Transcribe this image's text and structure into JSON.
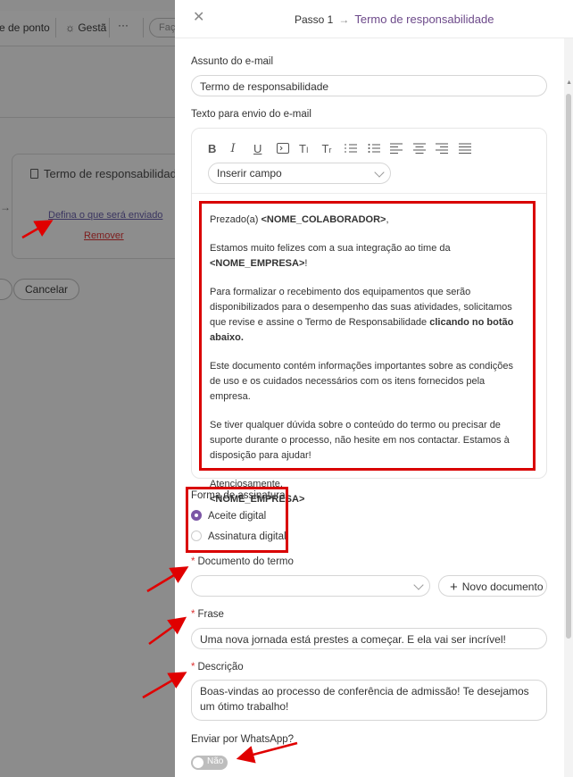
{
  "background": {
    "topbar": {
      "item1": "e de ponto",
      "item2": "Gestã",
      "more": "···",
      "search": "Faça"
    },
    "card": {
      "title": "Termo de responsabilidade",
      "define_link": "Defina o que será enviado",
      "remove_link": "Remover"
    },
    "cancel_button": "Cancelar"
  },
  "drawer": {
    "step_label": "Passo 1",
    "step_title": "Termo de responsabilidade"
  },
  "form": {
    "subject_label": "Assunto do e-mail",
    "subject_value": "Termo de responsabilidade",
    "body_label": "Texto para envio do e-mail",
    "insert_field": "Inserir campo",
    "editor": {
      "greeting_prefix": "Prezado(a) ",
      "greeting_var": "<NOME_COLABORADOR>",
      "greeting_suffix": ",",
      "p2_text": "Estamos muito felizes com a sua integração ao time da ",
      "p2_var": "<NOME_EMPRESA>",
      "p2_suffix": "!",
      "p3_text": "Para formalizar o recebimento dos equipamentos que serão disponibilizados para o desempenho das suas atividades, solicitamos que revise e assine o Termo de Responsabilidade ",
      "p3_bold": "clicando no botão abaixo.",
      "p4": "Este documento contém informações importantes sobre as condições de uso e os cuidados necessários com os itens fornecidos pela empresa.",
      "p5": "Se tiver qualquer dúvida sobre o conteúdo do termo ou precisar de suporte durante o processo, não hesite em nos contactar. Estamos à disposição para ajudar!",
      "closing": "Atenciosamente,",
      "signature_var": "<NOME_EMPRESA>"
    },
    "signature_label": "Forma de assinatura",
    "signature_options": [
      "Aceite digital",
      "Assinatura digital"
    ],
    "signature_selected": "Aceite digital",
    "document_label": "Documento do termo",
    "document_value": "",
    "new_document_button": "Novo documento",
    "phrase_label": "Frase",
    "phrase_value": "Uma nova jornada está prestes a começar. E ela vai ser incrível!",
    "description_label": "Descrição",
    "description_value": "Boas-vindas ao processo de conferência de admissão! Te desejamos um ótimo trabalho!",
    "whatsapp_label": "Enviar por WhatsApp?",
    "whatsapp_toggle": "Não"
  },
  "colors": {
    "accent": "#7c57a6",
    "highlight_red": "#d90000",
    "overlay": "#8c8c8c"
  },
  "icons": [
    "close-icon",
    "arrow-right-icon",
    "bold-icon",
    "italic-icon",
    "underline-icon",
    "code-icon",
    "font-size-icon",
    "clear-format-icon",
    "ordered-list-icon",
    "bullet-list-icon",
    "align-left-icon",
    "align-center-icon",
    "align-right-icon",
    "justify-icon",
    "chevron-down-icon",
    "plus-icon",
    "document-icon"
  ]
}
